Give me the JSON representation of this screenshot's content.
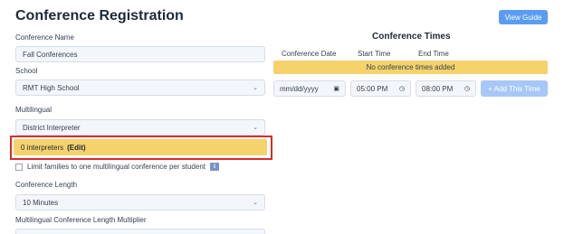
{
  "header": {
    "title": "Conference Registration",
    "view_guide_label": "View Guide"
  },
  "form": {
    "conference_name": {
      "label": "Conference Name",
      "value": "Fall Conferences"
    },
    "school": {
      "label": "School",
      "value": "RMT High School"
    },
    "multilingual": {
      "label": "Multilingual",
      "value": "District Interpreter"
    },
    "interpreters": {
      "count_text": "0 interpreters",
      "edit_label": "(Edit)"
    },
    "limit_families": {
      "label": "Limit families to one multilingual conference per student",
      "info_glyph": "i"
    },
    "conference_length": {
      "label": "Conference Length",
      "value": "10 Minutes"
    },
    "multiplier": {
      "label": "Multilingual Conference Length Multiplier"
    }
  },
  "conference_times": {
    "title": "Conference Times",
    "columns": [
      "Conference Date",
      "Start Time",
      "End Time"
    ],
    "empty_message": "No conference times added",
    "date_value": "mm/dd/yyyy",
    "start_value": "05:00 PM",
    "end_value": "08:00 PM",
    "add_label": "+ Add This Time"
  },
  "colors": {
    "accent": "#5b9cf2",
    "warning_bar": "#f5d26c",
    "highlight_outline": "#d92b2b"
  }
}
